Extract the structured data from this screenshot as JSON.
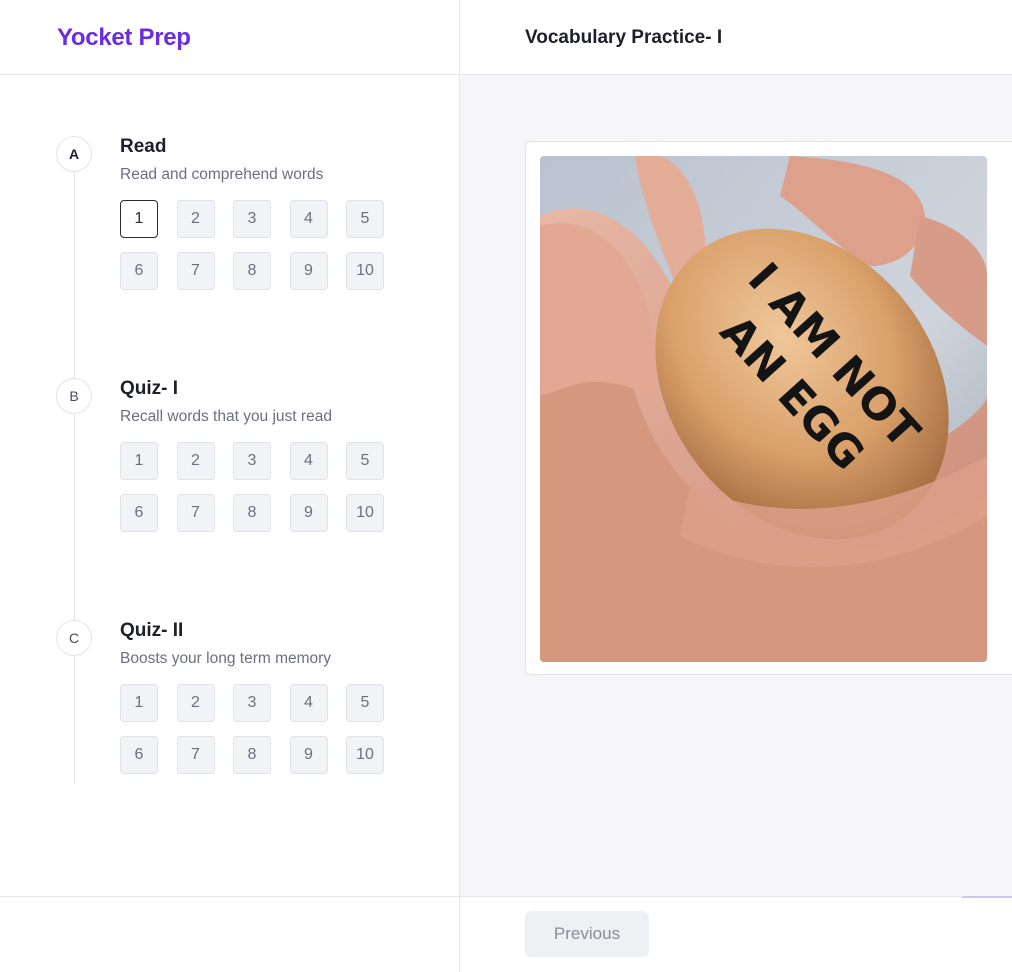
{
  "brand": {
    "name": "Yocket Prep",
    "color": "#6a2ee0"
  },
  "header": {
    "title": "Vocabulary Practice- I"
  },
  "sections": [
    {
      "letter": "A",
      "title": "Read",
      "subtitle": "Read and comprehend words",
      "items": [
        "1",
        "2",
        "3",
        "4",
        "5",
        "6",
        "7",
        "8",
        "9",
        "10"
      ],
      "current": "1"
    },
    {
      "letter": "B",
      "title": "Quiz- I",
      "subtitle": "Recall words that you just read",
      "items": [
        "1",
        "2",
        "3",
        "4",
        "5",
        "6",
        "7",
        "8",
        "9",
        "10"
      ]
    },
    {
      "letter": "C",
      "title": "Quiz- II",
      "subtitle": "Boosts your long term memory",
      "items": [
        "1",
        "2",
        "3",
        "4",
        "5",
        "6",
        "7",
        "8",
        "9",
        "10"
      ]
    }
  ],
  "image": {
    "egg_text_line1": "I AM NOT",
    "egg_text_line2": "AN EGG"
  },
  "footer": {
    "previous_label": "Previous"
  }
}
